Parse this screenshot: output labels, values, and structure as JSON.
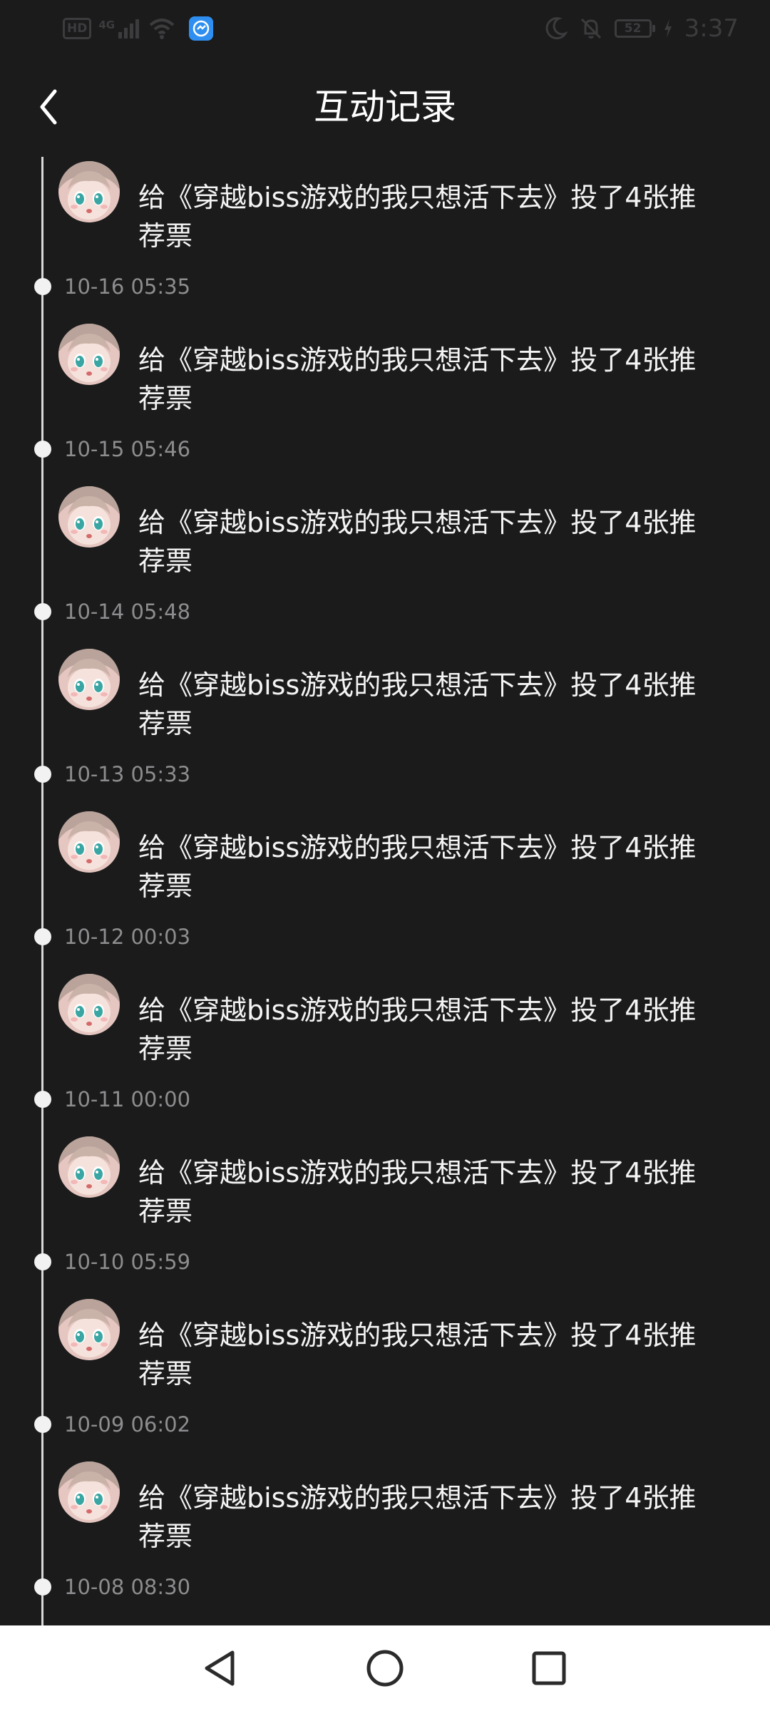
{
  "status_bar": {
    "hd": "HD",
    "network": "4G",
    "battery": "52",
    "time": "3:37"
  },
  "header": {
    "title": "互动记录",
    "back_icon": "chevron-left-icon"
  },
  "colors": {
    "background": "#1b1b1c",
    "text": "#f4f4f4",
    "timestamp": "#8d8d8f",
    "timeline": "#d8d8d8",
    "nav_bar": "#ffffff"
  },
  "records": [
    {
      "text": "给《穿越biss游戏的我只想活下去》投了4张推荐票",
      "time": "10-16 05:35"
    },
    {
      "text": "给《穿越biss游戏的我只想活下去》投了4张推荐票",
      "time": "10-15 05:46"
    },
    {
      "text": "给《穿越biss游戏的我只想活下去》投了4张推荐票",
      "time": "10-14 05:48"
    },
    {
      "text": "给《穿越biss游戏的我只想活下去》投了4张推荐票",
      "time": "10-13 05:33"
    },
    {
      "text": "给《穿越biss游戏的我只想活下去》投了4张推荐票",
      "time": "10-12 00:03"
    },
    {
      "text": "给《穿越biss游戏的我只想活下去》投了4张推荐票",
      "time": "10-11 00:00"
    },
    {
      "text": "给《穿越biss游戏的我只想活下去》投了4张推荐票",
      "time": "10-10 05:59"
    },
    {
      "text": "给《穿越biss游戏的我只想活下去》投了4张推荐票",
      "time": "10-09 06:02"
    },
    {
      "text": "给《穿越biss游戏的我只想活下去》投了4张推荐票",
      "time": "10-08 08:30"
    }
  ],
  "nav": {
    "back": "back-triangle-icon",
    "home": "home-circle-icon",
    "recents": "recents-square-icon"
  }
}
